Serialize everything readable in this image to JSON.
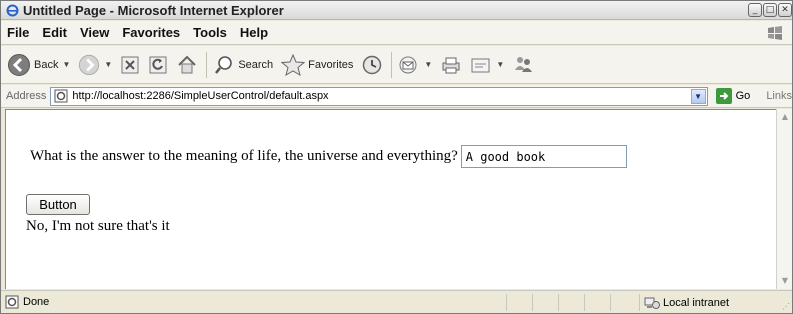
{
  "window": {
    "title": "Untitled Page - Microsoft Internet Explorer",
    "controls": [
      "_",
      "□",
      "✕"
    ]
  },
  "menu": [
    "File",
    "Edit",
    "View",
    "Favorites",
    "Tools",
    "Help"
  ],
  "toolbar": {
    "back_label": "Back",
    "search_label": "Search",
    "favorites_label": "Favorites"
  },
  "address": {
    "label": "Address",
    "url": "http://localhost:2286/SimpleUserControl/default.aspx",
    "go_label": "Go",
    "links_label": "Links"
  },
  "page": {
    "question": "What is the answer to the meaning of life, the universe and everything?",
    "answer_value": "A good book",
    "button_label": "Button",
    "result": "No, I'm not sure that's it"
  },
  "status": {
    "text": "Done",
    "zone": "Local intranet"
  }
}
